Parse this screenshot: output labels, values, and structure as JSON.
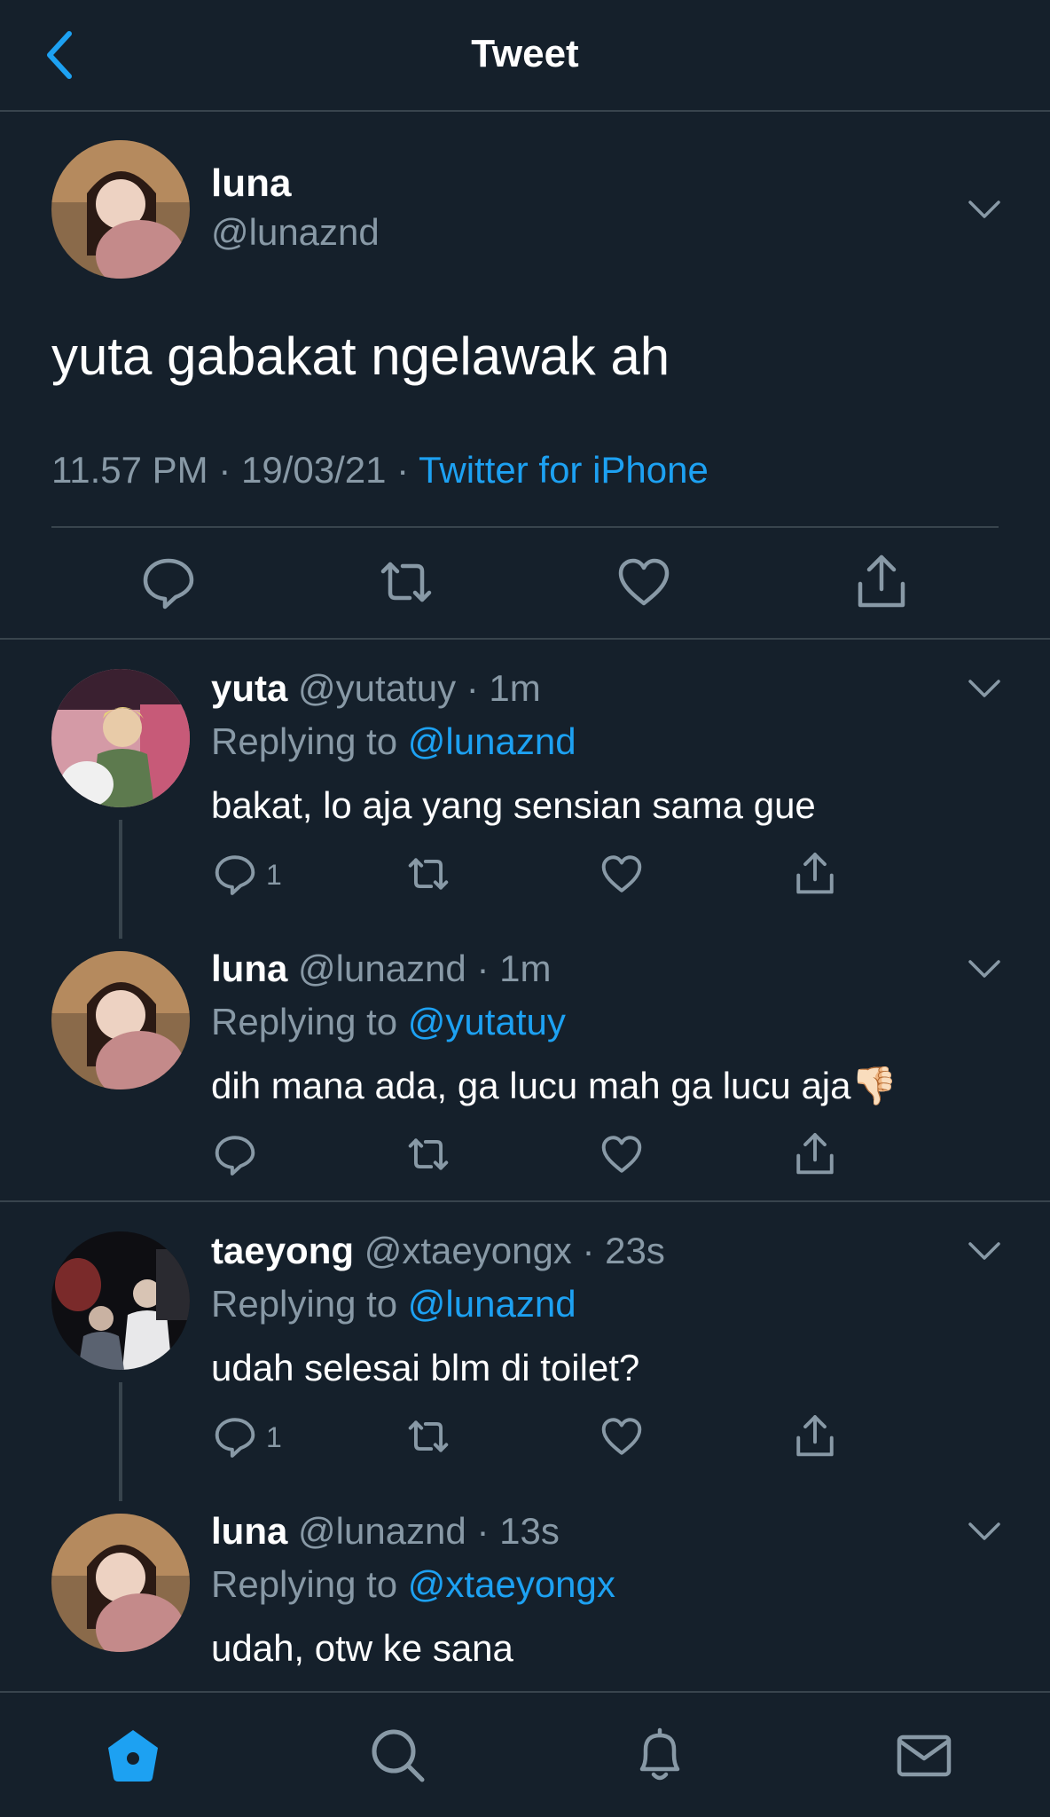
{
  "header": {
    "title": "Tweet",
    "back_icon": "chevron-left-icon"
  },
  "colors": {
    "background": "#15202b",
    "accent": "#1da1f2",
    "muted": "#8899a6",
    "divider": "#38444d"
  },
  "main_tweet": {
    "name": "luna",
    "handle": "@lunaznd",
    "text": "yuta gabakat ngelawak ah",
    "time": "11.57 PM · 19/03/21 · ",
    "source": "Twitter for iPhone"
  },
  "replies": [
    {
      "name": "yuta",
      "meta": " @yutatuy · 1m",
      "replying_label": "Replying to ",
      "replying_to": "@lunaznd",
      "text": "bakat, lo aja yang sensian sama gue",
      "reply_count": "1"
    },
    {
      "name": "luna",
      "meta": " @lunaznd · 1m",
      "replying_label": "Replying to ",
      "replying_to": "@yutatuy",
      "text": "dih mana ada, ga lucu mah ga lucu aja",
      "emoji": "👎🏻",
      "reply_count": ""
    },
    {
      "name": "taeyong",
      "meta": " @xtaeyongx · 23s",
      "replying_label": "Replying to ",
      "replying_to": "@lunaznd",
      "text": "udah selesai blm di toilet?",
      "reply_count": "1"
    },
    {
      "name": "luna",
      "meta": " @lunaznd · 13s",
      "replying_label": "Replying to ",
      "replying_to": "@xtaeyongx",
      "text": "udah, otw ke sana",
      "reply_count": ""
    }
  ],
  "tabs": [
    "home-icon",
    "search-icon",
    "notifications-bell-icon",
    "messages-envelope-icon"
  ]
}
